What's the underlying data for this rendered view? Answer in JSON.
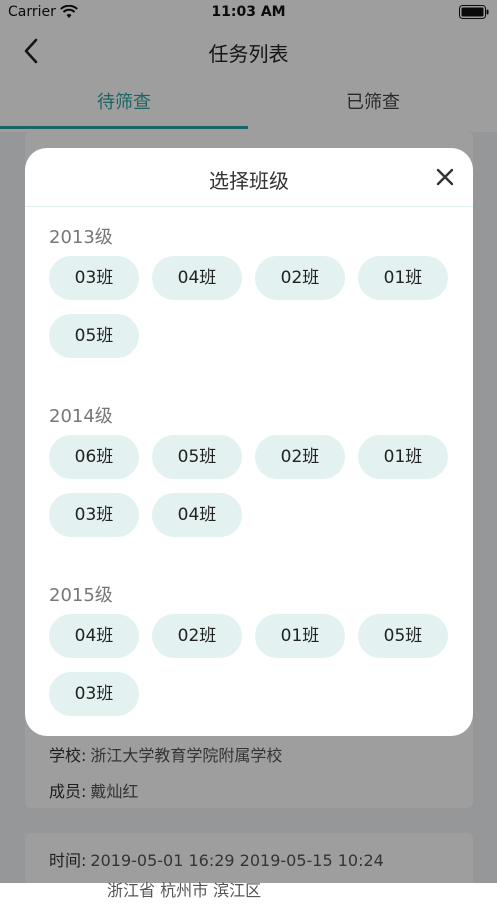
{
  "status": {
    "carrier": "Carrier",
    "time": "11:03 AM"
  },
  "nav": {
    "title": "任务列表"
  },
  "tabs": [
    {
      "label": "待筛查",
      "active": true
    },
    {
      "label": "已筛查",
      "active": false
    }
  ],
  "cards": [
    {
      "school_label": "学校:",
      "school": "浙江大学教育学院附属学校",
      "members_label": "成员:",
      "members": "戴灿红"
    },
    {
      "time_label": "时间:",
      "time": "2019-05-01 16:29    2019-05-15 10:24",
      "address": "浙江省 杭州市 滨江区"
    }
  ],
  "modal": {
    "title": "选择班级",
    "grades": [
      {
        "label": "2013级",
        "classes": [
          "03班",
          "04班",
          "02班",
          "01班",
          "05班"
        ]
      },
      {
        "label": "2014级",
        "classes": [
          "06班",
          "05班",
          "02班",
          "01班",
          "03班",
          "04班"
        ]
      },
      {
        "label": "2015级",
        "classes": [
          "04班",
          "02班",
          "01班",
          "05班",
          "03班"
        ]
      }
    ]
  },
  "colors": {
    "accent": "#2fa4a1",
    "chip_bg": "#e3f1f1",
    "overlay": "rgba(0,0,0,0.38)"
  }
}
